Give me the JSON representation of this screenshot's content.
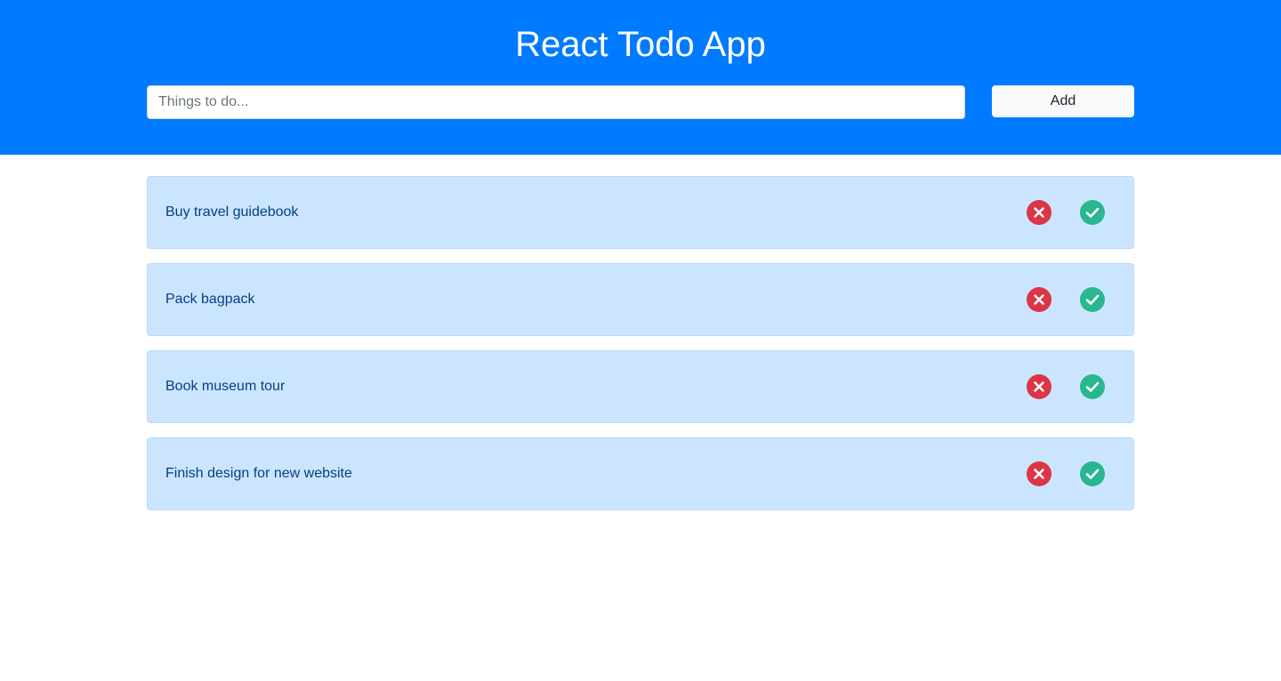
{
  "header": {
    "title": "React Todo App",
    "input_placeholder": "Things to do...",
    "input_value": "",
    "add_label": "Add"
  },
  "todos": [
    {
      "text": "Buy travel guidebook",
      "delete_icon": "x-circle-icon",
      "done_icon": "check-circle-icon"
    },
    {
      "text": "Pack bagpack",
      "delete_icon": "x-circle-icon",
      "done_icon": "check-circle-icon"
    },
    {
      "text": "Book museum tour",
      "delete_icon": "x-circle-icon",
      "done_icon": "check-circle-icon"
    },
    {
      "text": "Finish design for new website",
      "delete_icon": "x-circle-icon",
      "done_icon": "check-circle-icon"
    }
  ],
  "colors": {
    "header_bg": "#007bff",
    "item_bg": "#cce5ff",
    "item_text": "#004085",
    "delete": "#dc3545",
    "done": "#28b78f"
  }
}
